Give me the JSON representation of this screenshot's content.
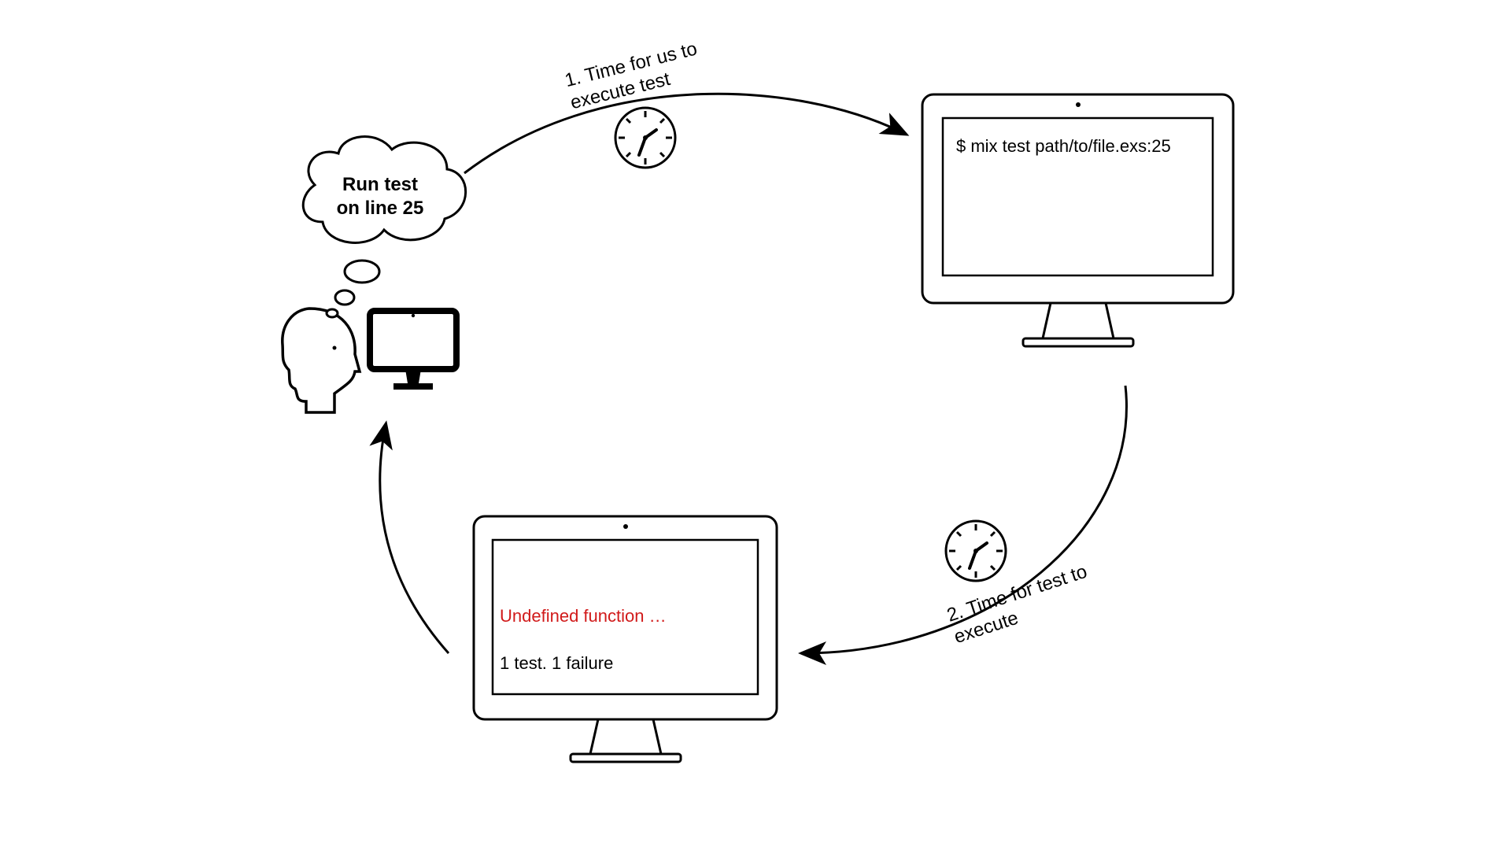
{
  "thought_bubble": {
    "line1": "Run test",
    "line2": "on line 25"
  },
  "arrows": {
    "step1_line1": "1. Time for us to",
    "step1_line2": "execute test",
    "step2_line1": "2. Time for test to",
    "step2_line2": "execute"
  },
  "top_terminal": {
    "command": "$ mix test path/to/file.exs:25"
  },
  "bottom_terminal": {
    "error_line": "Undefined function …",
    "summary_line": "1 test. 1 failure"
  },
  "colors": {
    "error": "#d11a1a",
    "stroke": "#000000"
  }
}
